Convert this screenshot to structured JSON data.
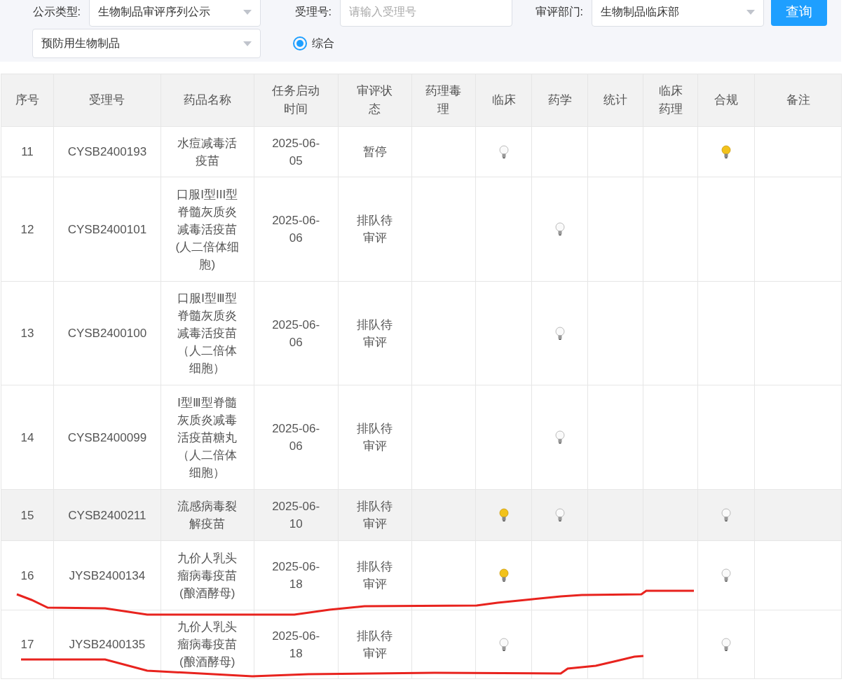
{
  "filters": {
    "type_label": "公示类型:",
    "type_value": "生物制品审评序列公示",
    "number_label": "受理号:",
    "number_placeholder": "请输入受理号",
    "dept_label": "审评部门:",
    "dept_value": "生物制品临床部",
    "query_button": "查询",
    "category_value": "预防用生物制品",
    "radio": {
      "label": "综合",
      "selected": true
    }
  },
  "table": {
    "columns": [
      "序号",
      "受理号",
      "药品名称",
      "任务启动时间",
      "审评状态",
      "药理毒理",
      "临床",
      "药学",
      "统计",
      "临床药理",
      "合规",
      "备注"
    ],
    "rows": [
      {
        "no": "11",
        "number": "CYSB2400193",
        "name": "水痘减毒活疫苗",
        "date": "2025-06-05",
        "status": "暂停",
        "bulbs": {
          "clinical": {
            "lit": false
          },
          "compliance": {
            "lit": true
          }
        },
        "highlighted": false
      },
      {
        "no": "12",
        "number": "CYSB2400101",
        "name": "口服I型III型脊髓灰质炎减毒活疫苗(人二倍体细胞)",
        "date": "2025-06-06",
        "status": "排队待审评",
        "bulbs": {
          "pharmacy": {
            "lit": false
          }
        },
        "highlighted": false
      },
      {
        "no": "13",
        "number": "CYSB2400100",
        "name": "口服Ⅰ型Ⅲ型脊髓灰质炎减毒活疫苗（人二倍体细胞）",
        "date": "2025-06-06",
        "status": "排队待审评",
        "bulbs": {
          "pharmacy": {
            "lit": false
          }
        },
        "highlighted": false
      },
      {
        "no": "14",
        "number": "CYSB2400099",
        "name": "Ⅰ型Ⅲ型脊髓灰质炎减毒活疫苗糖丸（人二倍体细胞）",
        "date": "2025-06-06",
        "status": "排队待审评",
        "bulbs": {
          "pharmacy": {
            "lit": false
          }
        },
        "highlighted": false
      },
      {
        "no": "15",
        "number": "CYSB2400211",
        "name": "流感病毒裂解疫苗",
        "date": "2025-06-10",
        "status": "排队待审评",
        "bulbs": {
          "clinical": {
            "lit": true
          },
          "pharmacy": {
            "lit": false
          },
          "compliance": {
            "lit": false
          }
        },
        "highlighted": true
      },
      {
        "no": "16",
        "number": "JYSB2400134",
        "name": "九价人乳头瘤病毒疫苗(酿酒酵母)",
        "date": "2025-06-18",
        "status": "排队待审评",
        "bulbs": {
          "clinical": {
            "lit": true
          },
          "compliance": {
            "lit": false
          }
        },
        "highlighted": false
      },
      {
        "no": "17",
        "number": "JYSB2400135",
        "name": "九价人乳头瘤病毒疫苗(酿酒酵母)",
        "date": "2025-06-18",
        "status": "排队待审评",
        "bulbs": {
          "clinical": {
            "lit": false
          },
          "compliance": {
            "lit": false
          }
        },
        "highlighted": false
      }
    ]
  }
}
